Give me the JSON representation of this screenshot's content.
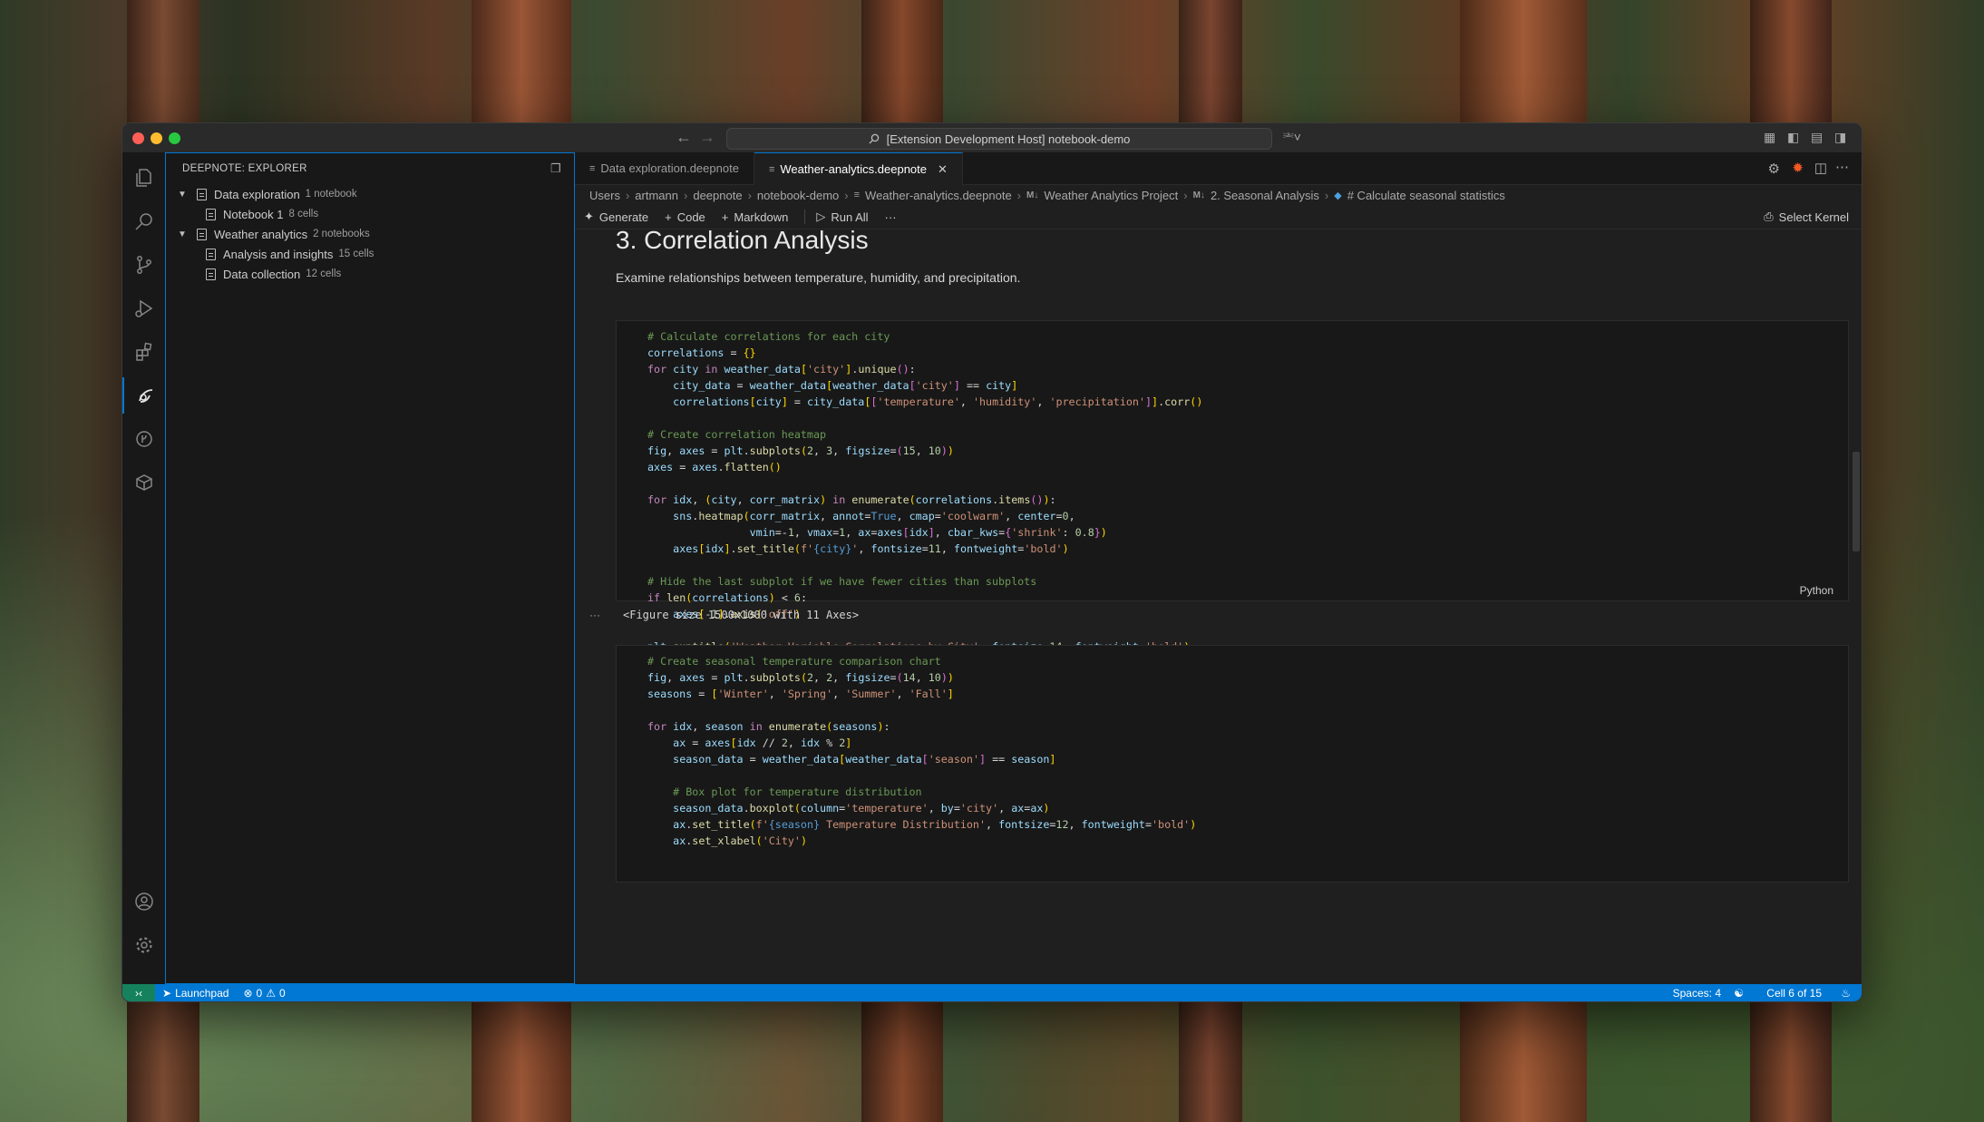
{
  "window": {
    "command_center": "[Extension Development Host] notebook-demo"
  },
  "sidebar": {
    "title": "DEEPNOTE: EXPLORER",
    "tree": [
      {
        "label": "Data exploration",
        "meta": "1 notebook"
      },
      {
        "label": "Notebook 1",
        "meta": "8 cells"
      },
      {
        "label": "Weather analytics",
        "meta": "2 notebooks"
      },
      {
        "label": "Analysis and insights",
        "meta": "15 cells"
      },
      {
        "label": "Data collection",
        "meta": "12 cells"
      }
    ]
  },
  "tabs": [
    {
      "label": "Data exploration.deepnote"
    },
    {
      "label": "Weather-analytics.deepnote"
    }
  ],
  "breadcrumb": [
    "Users",
    "artmann",
    "deepnote",
    "notebook-demo",
    "Weather-analytics.deepnote",
    "Weather Analytics Project",
    "2. Seasonal Analysis",
    "# Calculate seasonal statistics"
  ],
  "toolbar": {
    "generate": "Generate",
    "code": "Code",
    "markdown": "Markdown",
    "run_all": "Run All",
    "more": "···",
    "select_kernel": "Select Kernel"
  },
  "notebook": {
    "heading": "3. Correlation Analysis",
    "paragraph": "Examine relationships between temperature, humidity, and precipitation.",
    "cell1_language": "Python",
    "output_text": "<Figure size 1500x1000 with 11 Axes>",
    "output_ellipsis": "···"
  },
  "statusbar": {
    "launchpad": "Launchpad",
    "errors": "0",
    "warnings": "0",
    "spaces": "Spaces: 4",
    "cell_pos": "Cell 6 of 15"
  },
  "colors": {
    "accent": "#0078d4",
    "remote": "#16825d",
    "editor_bg": "#1f1f1f"
  }
}
